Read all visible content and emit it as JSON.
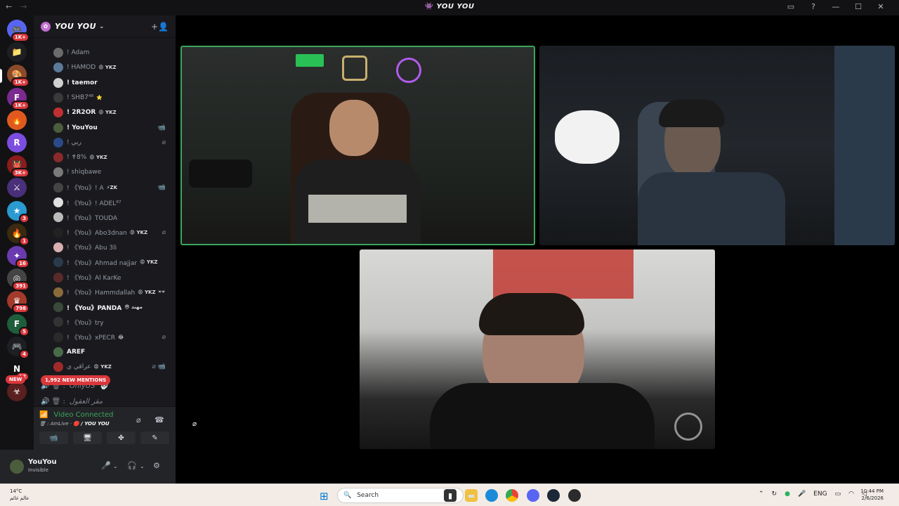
{
  "window": {
    "title": "YOU YOU",
    "back": "←",
    "forward": "→",
    "title_icon": "👾",
    "buttons": [
      "▭",
      "?",
      "—",
      "☐",
      "✕"
    ]
  },
  "servers": [
    {
      "label": "🎮",
      "badge": "1K+",
      "color": "#5865f2"
    },
    {
      "label": "📁",
      "badge": "",
      "color": "#1e1f22"
    },
    {
      "label": "🎨",
      "badge": "1K+",
      "color": "#8a4b2a"
    },
    {
      "label": "F",
      "badge": "1K+",
      "color": "#7a2a90"
    },
    {
      "label": "🔥",
      "badge": "",
      "color": "#e05a1f"
    },
    {
      "label": "R",
      "badge": "",
      "color": "#7b4ee0"
    },
    {
      "label": "👹",
      "badge": "3K+",
      "color": "#8c1c1c"
    },
    {
      "label": "⚔",
      "badge": "",
      "color": "#4a2f7a"
    },
    {
      "label": "★",
      "badge": "3",
      "color": "#2b9ad1"
    },
    {
      "label": "🔥",
      "badge": "1",
      "color": "#3a2a10"
    },
    {
      "label": "✦",
      "badge": "16",
      "color": "#6a3bb0"
    },
    {
      "label": "◎",
      "badge": "391",
      "color": "#444"
    },
    {
      "label": "♛",
      "badge": "798",
      "color": "#a33a2a"
    },
    {
      "label": "F",
      "badge": "5",
      "color": "#1e5e3a"
    },
    {
      "label": "🎮",
      "badge": "4",
      "color": "#1e1f22"
    },
    {
      "label": "N",
      "badge": "12",
      "color": "#111"
    },
    {
      "label": "☣",
      "badge": "",
      "color": "#5a1f1f"
    }
  ],
  "new_badge": "NEW",
  "server_header": {
    "name": "YOU YOU",
    "chevron": "⌄",
    "add_icon": "+👤"
  },
  "members": [
    {
      "name": "! Adam",
      "tag": "",
      "bright": false,
      "avatar": "#6b6b6b",
      "right": ""
    },
    {
      "name": "! HAMOD",
      "tag": "😡 YKZ",
      "bright": false,
      "avatar": "#5a7a9a",
      "right": ""
    },
    {
      "name": "! taemor",
      "tag": "",
      "bright": true,
      "avatar": "#d0d0d0",
      "right": ""
    },
    {
      "name": "! SHB7⁴⁸",
      "tag": "⭐",
      "bright": false,
      "avatar": "#3a3a3a",
      "right": ""
    },
    {
      "name": "! 2R2OR",
      "tag": "😡 YKZ",
      "bright": true,
      "avatar": "#c03030",
      "right": ""
    },
    {
      "name": "! YouYou",
      "tag": "",
      "bright": true,
      "avatar": "#4a5d3c",
      "right": "📹"
    },
    {
      "name": "! ربي",
      "tag": "",
      "bright": false,
      "avatar": "#2a4a8a",
      "right": "⌀"
    },
    {
      "name": "! ✝8%",
      "tag": "😡 YKZ",
      "bright": false,
      "avatar": "#8a2a2a",
      "right": ""
    },
    {
      "name": "! shiqbawe",
      "tag": "",
      "bright": false,
      "avatar": "#7a7a7a",
      "right": ""
    },
    {
      "name": "! 《You》! A",
      "tag": "⚡ZK",
      "bright": false,
      "avatar": "#444",
      "right": "📹"
    },
    {
      "name": "! 《You》! ADEL⁸⁷",
      "tag": "",
      "bright": false,
      "avatar": "#e0e0e0",
      "right": ""
    },
    {
      "name": "! 《You》TOUDA",
      "tag": "",
      "bright": false,
      "avatar": "#bbb",
      "right": ""
    },
    {
      "name": "! 《You》Abo3dnan",
      "tag": "😡 YKZ",
      "bright": false,
      "avatar": "#222",
      "right": "⌀"
    },
    {
      "name": "! 《You》Abu 3li",
      "tag": "",
      "bright": false,
      "avatar": "#d8b0b0",
      "right": ""
    },
    {
      "name": "! 《You》Ahmad najjar",
      "tag": "😡 YKZ",
      "bright": false,
      "avatar": "#2a3a4a",
      "right": ""
    },
    {
      "name": "! 《You》Al KarKe",
      "tag": "",
      "bright": false,
      "avatar": "#5a2a2a",
      "right": ""
    },
    {
      "name": "! 《You》Hammdallah",
      "tag": "😡 YKZ",
      "bright": false,
      "avatar": "#8a6a3a",
      "right": "👓"
    },
    {
      "name": "! 《You》PANDA",
      "tag": "😎 مهند",
      "bright": true,
      "avatar": "#3a4a3a",
      "right": ""
    },
    {
      "name": "! 《You》try",
      "tag": "",
      "bright": false,
      "avatar": "#333",
      "right": ""
    },
    {
      "name": "! 《You》xPECR",
      "tag": "😂",
      "bright": false,
      "avatar": "#2a2a2a",
      "right": "⌀"
    },
    {
      "name": "AREF",
      "tag": "",
      "bright": true,
      "avatar": "#4a6a4a",
      "right": ""
    },
    {
      "name": "عراقي ي",
      "tag": "😡 YKZ",
      "bright": false,
      "avatar": "#a02a2a",
      "right": "⌀ 📹"
    }
  ],
  "voice_channels": [
    {
      "name": "OnlyUS",
      "icon": "🔊 🗑 :",
      "emoji": "💀"
    },
    {
      "name": "مقر العقول",
      "icon": "🔊 🗑 :",
      "emoji": ""
    }
  ],
  "mentions_badge": "1,992 NEW MENTIONS",
  "voice_status": {
    "label": "Video Connected",
    "signal_icon": "📶",
    "detail_prefix": "AmLive",
    "detail_channel": "/ YOU YOU",
    "noise_icon": "⌀",
    "disconnect_icon": "☎"
  },
  "rtc_buttons": [
    {
      "name": "camera",
      "glyph": "📹"
    },
    {
      "name": "screen-share",
      "glyph": "🖥"
    },
    {
      "name": "activities",
      "glyph": "✤"
    },
    {
      "name": "soundboard",
      "glyph": "✎"
    }
  ],
  "user": {
    "name": "YouYou",
    "status": "Invisible",
    "mic": "🎤",
    "headset": "🎧",
    "settings": "⚙",
    "chev": "⌄"
  },
  "taskbar": {
    "weather_temp": "14°C",
    "weather_desc": "عالم غائم",
    "search_placeholder": "Search",
    "search_icon": "🔍",
    "lang": "ENG",
    "time": "10:44 PM",
    "date": "2/6/2026",
    "win_icon": "⊞",
    "tray_icons": [
      "⌃",
      "↻",
      "●",
      "🎤"
    ]
  },
  "stage": {
    "mute_icon": "⌀"
  }
}
